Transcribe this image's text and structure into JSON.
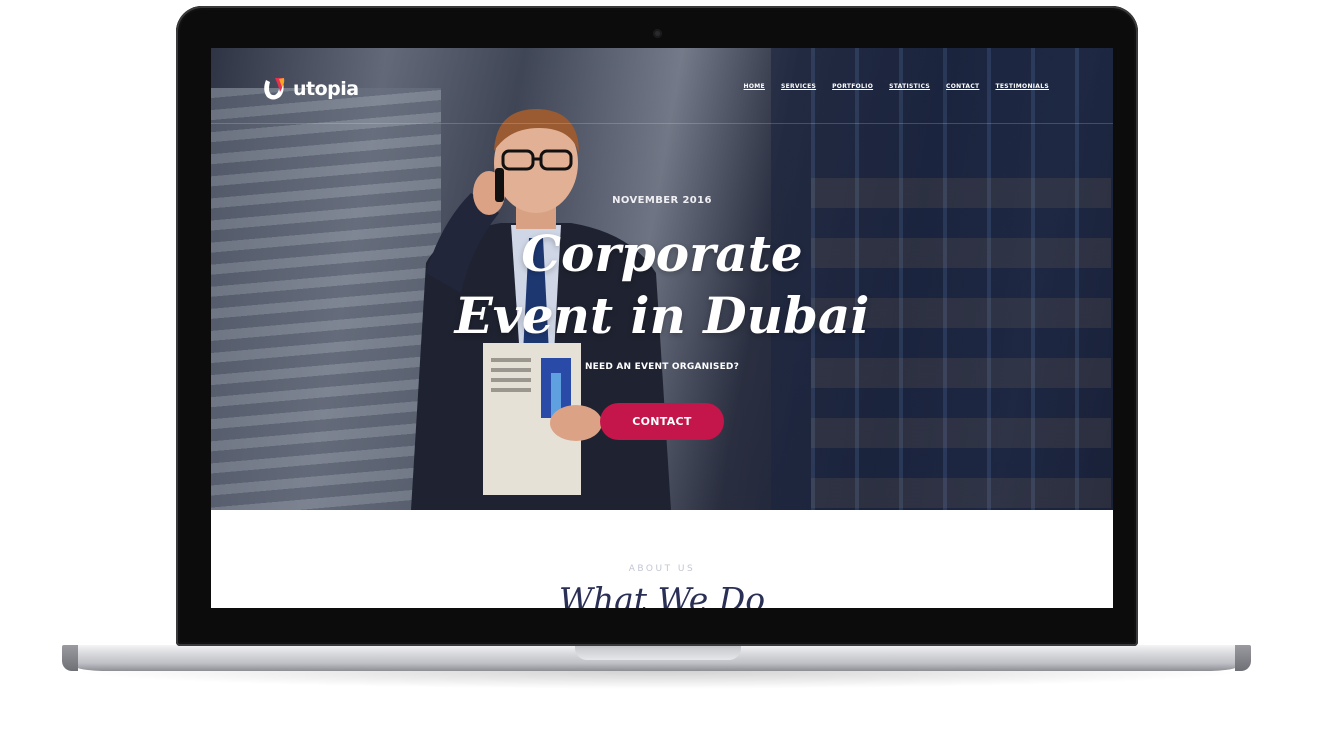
{
  "brand": {
    "name": "utopia"
  },
  "nav": {
    "items": [
      "HOME",
      "SERVICES",
      "PORTFOLIO",
      "STATISTICS",
      "CONTACT",
      "TESTIMONIALS"
    ]
  },
  "hero": {
    "date": "NOVEMBER 2016",
    "title_line1": "Corporate",
    "title_line2": "Event in Dubai",
    "subtitle": "NEED AN EVENT ORGANISED?",
    "button_label": "CONTACT"
  },
  "about": {
    "label": "ABOUT US",
    "title": "What We Do"
  },
  "colors": {
    "accent": "#c4164a",
    "heading_navy": "#2a2f55",
    "muted_label": "#c3c6d2"
  },
  "icons": {
    "logo_mark": "utopia-logo-mark-icon"
  }
}
